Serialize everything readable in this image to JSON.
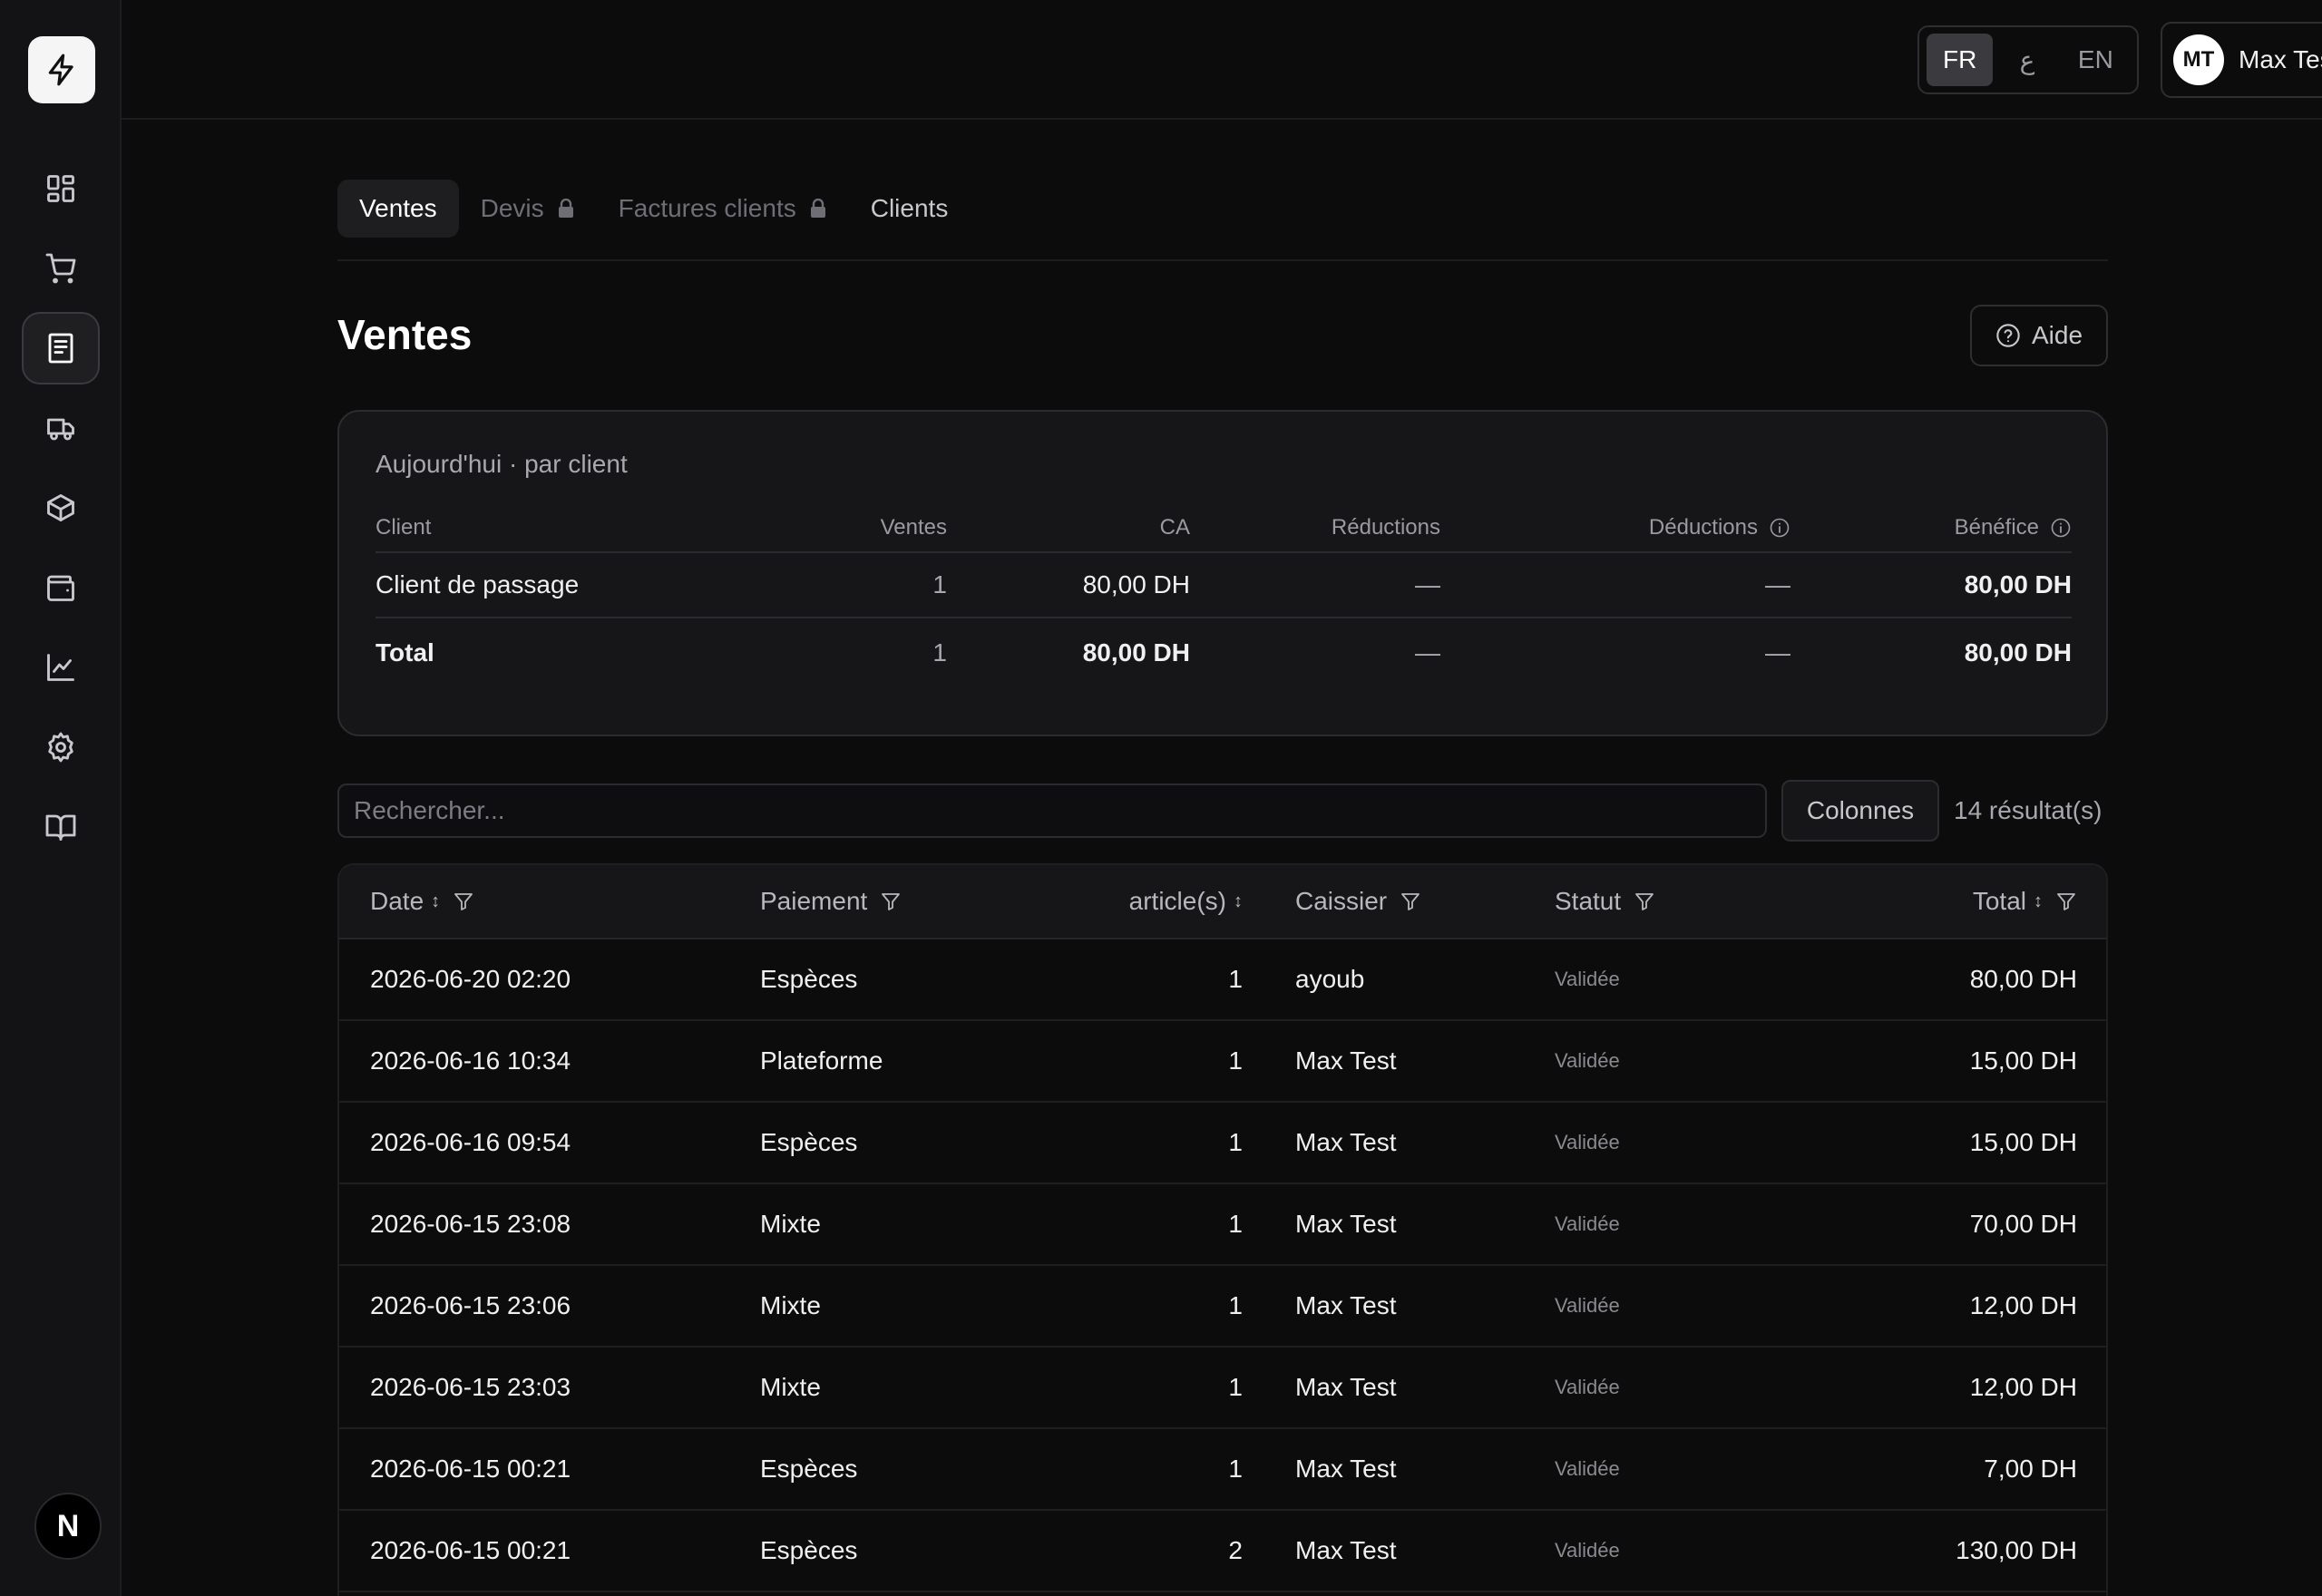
{
  "header": {
    "languages": [
      {
        "code": "FR",
        "active": true
      },
      {
        "code": "ع",
        "active": false
      },
      {
        "code": "EN",
        "active": false
      }
    ],
    "user": {
      "initials": "MT",
      "name": "Max Test"
    }
  },
  "sidebar": {
    "items": [
      {
        "icon": "dashboard-icon"
      },
      {
        "icon": "cart-icon"
      },
      {
        "icon": "receipt-icon",
        "active": true
      },
      {
        "icon": "truck-icon"
      },
      {
        "icon": "box-icon"
      },
      {
        "icon": "wallet-icon"
      },
      {
        "icon": "chart-icon"
      },
      {
        "icon": "gear-icon"
      },
      {
        "icon": "book-icon"
      }
    ],
    "badge": "N"
  },
  "tabs": [
    {
      "label": "Ventes",
      "active": true,
      "locked": false
    },
    {
      "label": "Devis",
      "active": false,
      "locked": true
    },
    {
      "label": "Factures clients",
      "active": false,
      "locked": true
    },
    {
      "label": "Clients",
      "active": false,
      "locked": false
    }
  ],
  "page": {
    "title": "Ventes",
    "help_label": "Aide"
  },
  "summary": {
    "subtitle": "Aujourd'hui · par client",
    "columns": [
      "Client",
      "Ventes",
      "CA",
      "Réductions",
      "Déductions",
      "Bénéfice"
    ],
    "rows": [
      {
        "client": "Client de passage",
        "ventes": "1",
        "ca": "80,00 DH",
        "reductions": "—",
        "deductions": "—",
        "benefice": "80,00 DH"
      }
    ],
    "total": {
      "client": "Total",
      "ventes": "1",
      "ca": "80,00 DH",
      "reductions": "—",
      "deductions": "—",
      "benefice": "80,00 DH"
    }
  },
  "toolbar": {
    "search_placeholder": "Rechercher...",
    "columns_label": "Colonnes",
    "results": "14 résultat(s)"
  },
  "table": {
    "columns": [
      "Date",
      "Paiement",
      "article(s)",
      "Caissier",
      "Statut",
      "Total"
    ],
    "rows": [
      {
        "date": "2026-06-20 02:20",
        "paiement": "Espèces",
        "articles": "1",
        "caissier": "ayoub",
        "statut": "Validée",
        "total": "80,00 DH"
      },
      {
        "date": "2026-06-16 10:34",
        "paiement": "Plateforme",
        "articles": "1",
        "caissier": "Max Test",
        "statut": "Validée",
        "total": "15,00 DH"
      },
      {
        "date": "2026-06-16 09:54",
        "paiement": "Espèces",
        "articles": "1",
        "caissier": "Max Test",
        "statut": "Validée",
        "total": "15,00 DH"
      },
      {
        "date": "2026-06-15 23:08",
        "paiement": "Mixte",
        "articles": "1",
        "caissier": "Max Test",
        "statut": "Validée",
        "total": "70,00 DH"
      },
      {
        "date": "2026-06-15 23:06",
        "paiement": "Mixte",
        "articles": "1",
        "caissier": "Max Test",
        "statut": "Validée",
        "total": "12,00 DH"
      },
      {
        "date": "2026-06-15 23:03",
        "paiement": "Mixte",
        "articles": "1",
        "caissier": "Max Test",
        "statut": "Validée",
        "total": "12,00 DH"
      },
      {
        "date": "2026-06-15 00:21",
        "paiement": "Espèces",
        "articles": "1",
        "caissier": "Max Test",
        "statut": "Validée",
        "total": "7,00 DH"
      },
      {
        "date": "2026-06-15 00:21",
        "paiement": "Espèces",
        "articles": "2",
        "caissier": "Max Test",
        "statut": "Validée",
        "total": "130,00 DH"
      }
    ]
  }
}
